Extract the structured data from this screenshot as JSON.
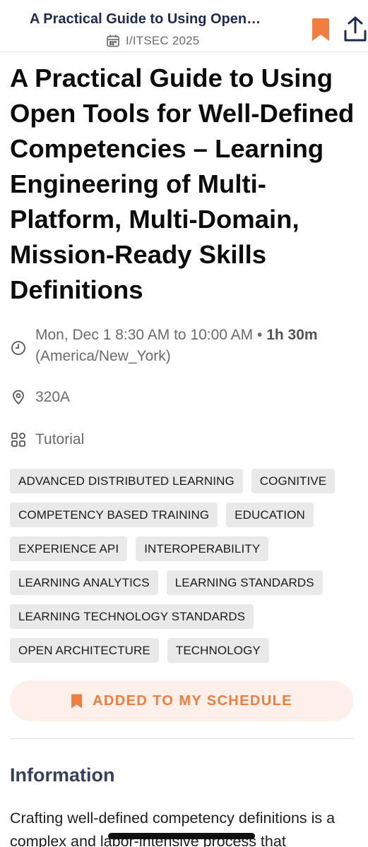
{
  "header": {
    "title": "A Practical Guide to Using Open…",
    "event_name": "I/ITSEC 2025",
    "icons": {
      "calendar": "calendar-icon",
      "bookmark": "bookmark-icon",
      "share": "share-icon"
    }
  },
  "session": {
    "title": "A Practical Guide to Using Open Tools for Well-Defined Competencies – Learning Engineering of Multi-Platform, Multi-Domain, Mission-Ready Skills Definitions",
    "time": {
      "range": "Mon, Dec 1 8:30 AM to 10:00 AM",
      "separator": "•",
      "duration": "1h 30m",
      "timezone": "(America/New_York)"
    },
    "room": "320A",
    "type": "Tutorial",
    "tags": [
      "ADVANCED DISTRIBUTED LEARNING",
      "COGNITIVE",
      "COMPETENCY BASED TRAINING",
      "EDUCATION",
      "EXPERIENCE API",
      "INTEROPERABILITY",
      "LEARNING ANALYTICS",
      "LEARNING STANDARDS",
      "LEARNING TECHNOLOGY STANDARDS",
      "OPEN ARCHITECTURE",
      "TECHNOLOGY"
    ],
    "schedule_button": "ADDED TO MY SCHEDULE"
  },
  "information": {
    "heading": "Information",
    "text": "Crafting well-defined competency definitions is a complex and labor-intensive process that"
  },
  "colors": {
    "header_title": "#1d2b52",
    "accent": "#ef7d3f",
    "accent_bg": "#fdf0ea",
    "tag_bg": "#e9e9e9",
    "section_title": "#36405a"
  }
}
